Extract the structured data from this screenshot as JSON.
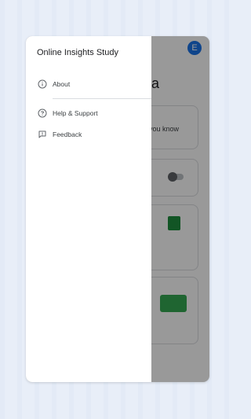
{
  "drawer": {
    "title": "Online Insights Study",
    "items": [
      {
        "label": "About",
        "icon": "info-icon"
      },
      {
        "label": "Help & Support",
        "icon": "help-icon"
      },
      {
        "label": "Feedback",
        "icon": "feedback-icon"
      }
    ]
  },
  "underlay": {
    "avatar_letter": "E",
    "title_fragment": "a",
    "card_text_fragment": "you know"
  }
}
